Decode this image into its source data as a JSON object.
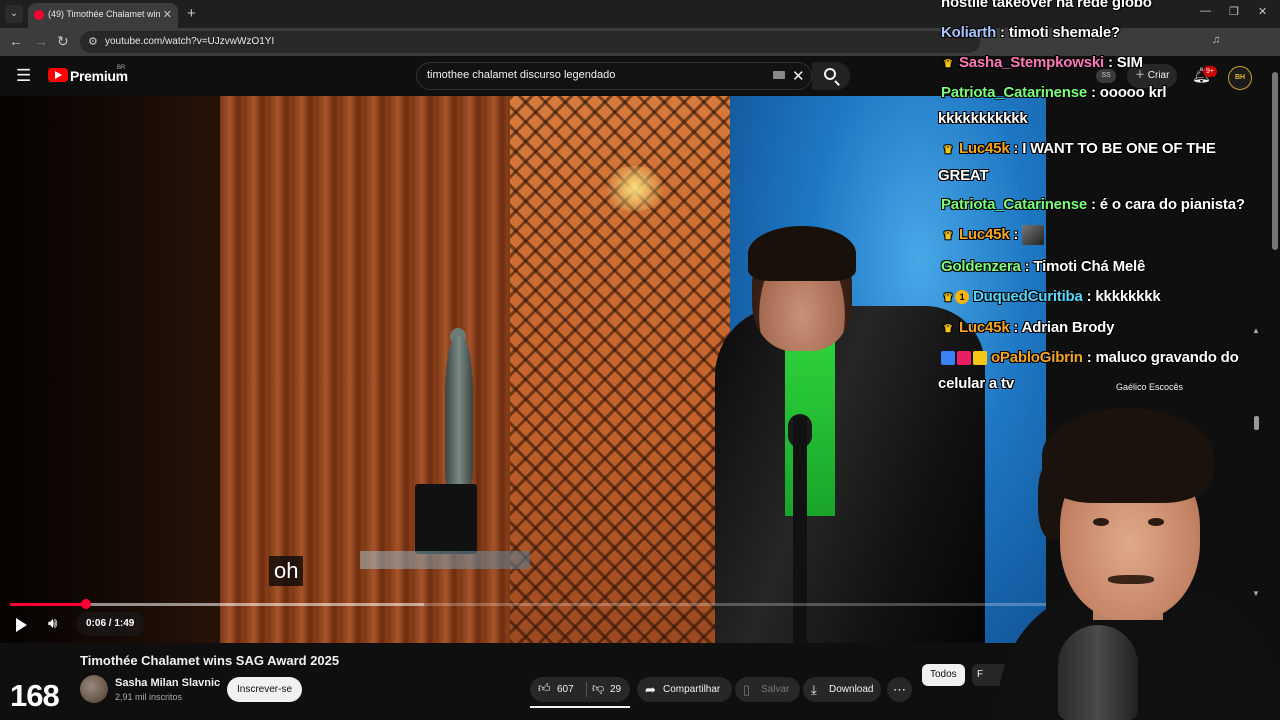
{
  "browser": {
    "tab_title": "(49) Timothée Chalamet wins S...",
    "url": "youtube.com/watch?v=UJzvwWzO1YI"
  },
  "youtube": {
    "brand": "Premium",
    "country_code": "BR",
    "search_value": "timothee chalamet discurso legendado",
    "create_label": "Criar",
    "notification_badge": "9+",
    "profile_initials": "BH",
    "streamer_tag": "SS"
  },
  "player": {
    "caption": "oh",
    "time": "0:06 / 1:49",
    "progress_played_fraction": 0.073,
    "progress_buffered_fraction": 0.4,
    "accent_color": "#ff0033"
  },
  "video": {
    "title": "Timothée Chalamet wins SAG Award 2025",
    "channel_name": "Sasha Milan Slavnic",
    "subscribers": "2,91 mil inscritos",
    "subscribe_label": "Inscrever-se",
    "likes": "607",
    "dislikes": "29",
    "share_label": "Compartilhar",
    "save_label": "Salvar",
    "download_label": "Download"
  },
  "sidebar": {
    "chip_all": "Todos",
    "chip_next": "F",
    "caption_language": "Gaélico Escocês"
  },
  "stream_overlay": {
    "viewer_count": "168",
    "chat": [
      {
        "user": "",
        "color": "#ffffff",
        "text": "hostile takeover na rede globo",
        "badges": "",
        "continuation": ""
      },
      {
        "user": "Koliarth",
        "color": "#a9c6ff",
        "text": "timoti shemale?",
        "badges": "",
        "continuation": ""
      },
      {
        "user": "Sasha_Stempkowski",
        "color": "#ff7ab6",
        "text": "SIM",
        "badges": "crown",
        "continuation": ""
      },
      {
        "user": "Patriota_Catarinense",
        "color": "#7cff7c",
        "text": "ooooo krl",
        "badges": "",
        "continuation": "kkkkkkkkkkk"
      },
      {
        "user": "Luc45k",
        "color": "#f5a623",
        "text": "I WANT TO BE ONE OF THE",
        "badges": "crown",
        "continuation": "GREAT"
      },
      {
        "user": "Patriota_Catarinense",
        "color": "#7cff7c",
        "text": "é o cara do pianista?",
        "badges": "",
        "continuation": ""
      },
      {
        "user": "Luc45k",
        "color": "#f5a623",
        "text": "",
        "badges": "crown",
        "continuation": "",
        "emote": true
      },
      {
        "user": "Goldenzera",
        "color": "#7cff7c",
        "text": "Timoti Chá Melê",
        "badges": "",
        "continuation": ""
      },
      {
        "user": "DuquedCuritiba",
        "color": "#55d9ff",
        "text": "kkkkkkkk",
        "badges": "crown-coin",
        "continuation": ""
      },
      {
        "user": "Luc45k",
        "color": "#f5a623",
        "text": "Adrian Brody",
        "badges": "crown",
        "continuation": ""
      },
      {
        "user": "oPabloGibrin",
        "color": "#f5a623",
        "text": "maluco gravando do",
        "badges": "multi",
        "continuation": "celular a tv"
      }
    ]
  }
}
